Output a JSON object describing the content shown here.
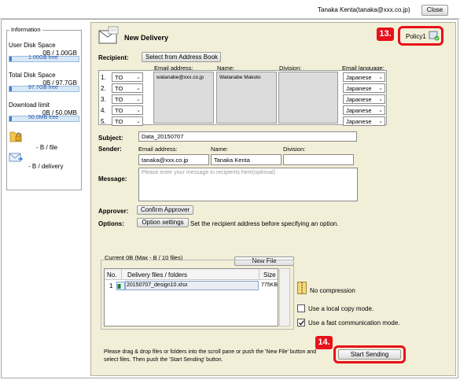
{
  "user": {
    "name_email": "Tanaka Kenta(tanaka@xxx.co.jp)",
    "close_label": "Close"
  },
  "info": {
    "title": "Information",
    "user_disk": {
      "label": "User Disk Space",
      "usage": "0B / 1.00GB",
      "free": "1.00GB free",
      "used_fraction": 0
    },
    "total_disk": {
      "label": "Total Disk Space",
      "usage": "0B / 97.7GB",
      "free": "97.7GB free",
      "used_fraction": 0
    },
    "download": {
      "label": "Download limit",
      "usage": "0B / 50.0MB",
      "free": "50.0MB free",
      "used_fraction": 0
    },
    "per_file": "- B / file",
    "per_delivery": "- B / delivery"
  },
  "delivery": {
    "title": "New Delivery",
    "policy_label": "Policy1",
    "callout_13": "13.",
    "callout_14": "14.",
    "recipient_label": "Recipient:",
    "address_book_label": "Select from Address Book",
    "headers": {
      "email": "Email address:",
      "name": "Name:",
      "division": "Division:",
      "language": "Email language:"
    },
    "recipients": [
      {
        "num": "1.",
        "type": "TO",
        "email": "watanabe@xxx.co.jp",
        "name": "Watanabe Makoto",
        "division": "",
        "language": "Japanese"
      },
      {
        "num": "2.",
        "type": "TO",
        "email": "",
        "name": "",
        "division": "",
        "language": "Japanese"
      },
      {
        "num": "3.",
        "type": "TO",
        "email": "",
        "name": "",
        "division": "",
        "language": "Japanese"
      },
      {
        "num": "4.",
        "type": "TO",
        "email": "",
        "name": "",
        "division": "",
        "language": "Japanese"
      },
      {
        "num": "5.",
        "type": "TO",
        "email": "",
        "name": "",
        "division": "",
        "language": "Japanese"
      }
    ],
    "subject_label": "Subject:",
    "subject_value": "Data_20150707",
    "sender_label": "Sender:",
    "sender_headers": {
      "email": "Email address:",
      "name": "Name:",
      "division": "Division:"
    },
    "sender_email": "tanaka@xxx.co.jp",
    "sender_name": "Tanaka Kenta",
    "sender_division": "",
    "message_label": "Message:",
    "message_placeholder": "Please enter your message to recipients here(optional)",
    "approver_label": "Approver:",
    "confirm_approver_label": "Confirm Approver",
    "options_label": "Options:",
    "option_settings_label": "Option settings",
    "options_hint": "Set the recipient address before specifying an option.",
    "files_summary": "Current 0B (Max - B / 10 files)",
    "new_file_label": "New File",
    "file_headers": {
      "no": "No.",
      "name": "Delivery files / folders",
      "size": "Size"
    },
    "files": [
      {
        "no": "1",
        "name": "20150707_design10.xlsx",
        "size": "775KB"
      }
    ],
    "no_compression": "No compression",
    "local_copy": {
      "label": "Use a local copy mode.",
      "checked": false
    },
    "fast_comm": {
      "label": "Use a fast communication mode.",
      "checked": true
    },
    "drag_hint": "Please drag & drop files or folders into the scroll pane or push the 'New File' button and select files. Then push the 'Start Sending' button.",
    "start_sending_label": "Start Sending"
  },
  "colors": {
    "accent": "#e8101a",
    "panel": "#f2efd8",
    "bar_blue": "#3d7fd0",
    "bar_bg": "#d9e8f7"
  }
}
